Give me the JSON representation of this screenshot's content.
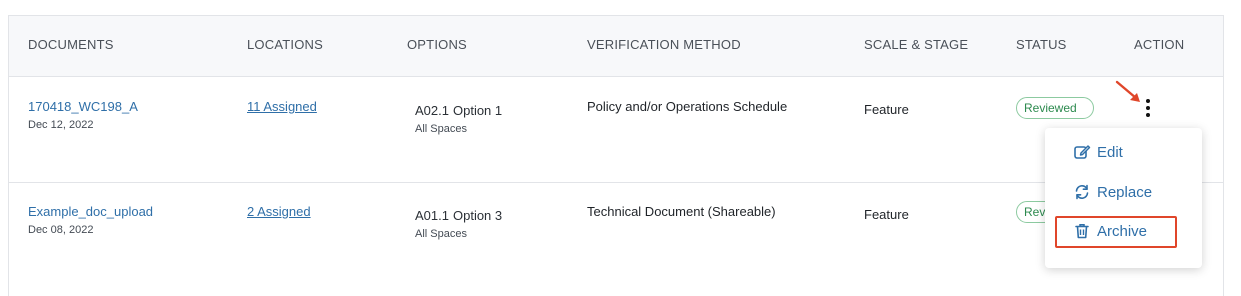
{
  "columns": [
    "DOCUMENTS",
    "LOCATIONS",
    "OPTIONS",
    "VERIFICATION METHOD",
    "SCALE & STAGE",
    "STATUS",
    "ACTION"
  ],
  "rows": [
    {
      "doc_name": "170418_WC198_A",
      "doc_date": "Dec 12, 2022",
      "locations": "11 Assigned",
      "option_code": "A02.1",
      "option_name": "Option 1",
      "option_scope": "All Spaces",
      "verification": "Policy and/or Operations Schedule",
      "scale": "Feature",
      "status": "Reviewed"
    },
    {
      "doc_name": "Example_doc_upload",
      "doc_date": "Dec 08, 2022",
      "locations": "2 Assigned",
      "option_code": "A01.1",
      "option_name": "Option 3",
      "option_scope": "All Spaces",
      "verification": "Technical Document (Shareable)",
      "scale": "Feature",
      "status": "Reviewed"
    }
  ],
  "action_menu": {
    "items": [
      {
        "label": "Edit",
        "icon": "edit-icon"
      },
      {
        "label": "Replace",
        "icon": "refresh-icon"
      },
      {
        "label": "Archive",
        "icon": "trash-icon"
      }
    ],
    "highlighted": "Archive"
  },
  "colors": {
    "link": "#2f6fa8",
    "status_border": "#8ccaa0",
    "status_text": "#2c8a4e",
    "highlight": "#e0462a",
    "header_bg": "#f7f8fa"
  },
  "icons": {
    "action": "kebab-menu-icon",
    "annotation": "arrow-pointer-icon"
  }
}
